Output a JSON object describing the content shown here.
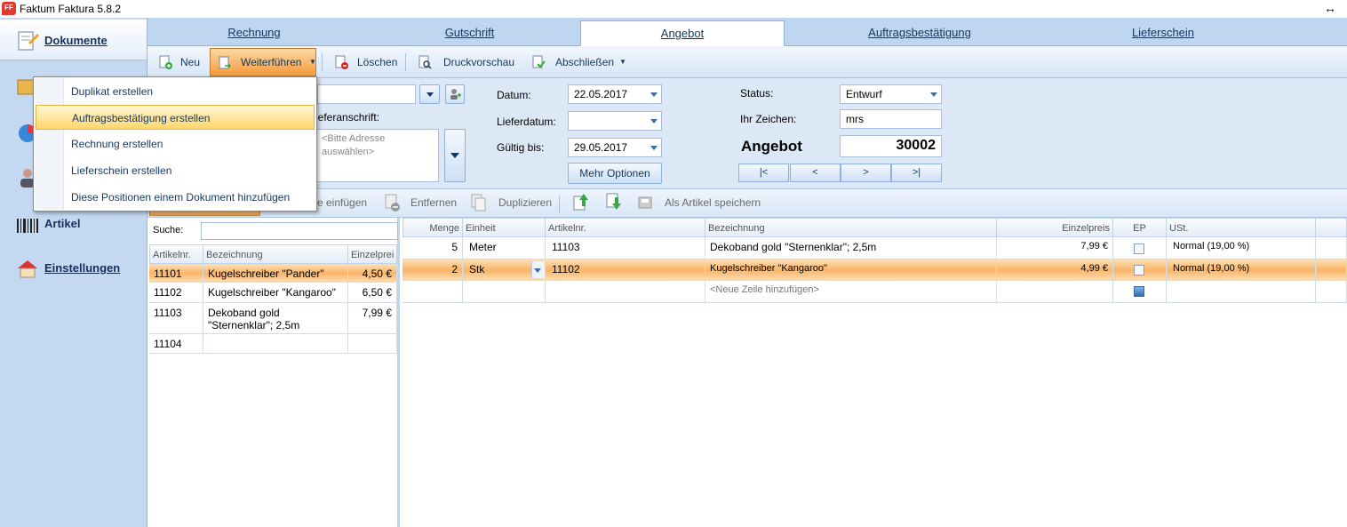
{
  "window": {
    "title": "Faktum Faktura 5.8.2",
    "logo_text": "FF"
  },
  "nav": {
    "items": [
      {
        "label": "Dokumente",
        "icon": "documents-icon"
      },
      {
        "label": "",
        "icon": "folder-icon"
      },
      {
        "label": "",
        "icon": "chart-icon"
      },
      {
        "label": "",
        "icon": "person-icon"
      },
      {
        "label": "Artikel",
        "icon": "barcode-icon"
      },
      {
        "label": "Einstellungen",
        "icon": "house-icon"
      }
    ]
  },
  "tabs": [
    "Rechnung",
    "Gutschrift",
    "Angebot",
    "Auftragsbestätigung",
    "Lieferschein"
  ],
  "active_tab": "Angebot",
  "toolbar": {
    "new": "Neu",
    "continue": "Weiterführen",
    "delete": "Löschen",
    "preview": "Druckvorschau",
    "complete": "Abschließen"
  },
  "menu": {
    "items": [
      "Duplikat erstellen",
      "Auftragsbestätigung erstellen",
      "Rechnung erstellen",
      "Lieferschein erstellen",
      "Diese Positionen einem Dokument hinzufügen"
    ],
    "highlighted": 1
  },
  "form": {
    "delivery_address_label": "ieferanschrift:",
    "address_placeholder_line1": "<Bitte Adresse",
    "address_placeholder_line2": "auswählen>",
    "date_label": "Datum:",
    "date_value": "22.05.2017",
    "delivery_date_label": "Lieferdatum:",
    "delivery_date_value": "",
    "valid_until_label": "Gültig bis:",
    "valid_until_value": "29.05.2017",
    "more_options": "Mehr Optionen",
    "status_label": "Status:",
    "status_value": "Entwurf",
    "your_sign_label": "Ihr Zeichen:",
    "your_sign_value": "mrs",
    "doc_type": "Angebot",
    "doc_number": "30002",
    "nav_first": "|<",
    "nav_prev": "<",
    "nav_next": ">",
    "nav_last": ">|"
  },
  "positions_toolbar": {
    "insert": "e einfügen",
    "remove": "Entfernen",
    "duplicate": "Duplizieren",
    "save_as_article": "Als Artikel speichern"
  },
  "articles": {
    "search_label": "Suche:",
    "headers": [
      "Artikelnr.",
      "Bezeichnung",
      "Einzelprei"
    ],
    "rows": [
      {
        "nr": "11101",
        "name": "Kugelschreiber \"Pander\"",
        "price": "4,50 €"
      },
      {
        "nr": "11102",
        "name": "Kugelschreiber \"Kangaroo\"",
        "price": "6,50 €"
      },
      {
        "nr": "11103",
        "name": "Dekoband gold \"Sternenklar\"; 2,5m",
        "price": "7,99 €"
      },
      {
        "nr": "11104",
        "name": "",
        "price": ""
      }
    ]
  },
  "positions": {
    "headers": [
      "Menge",
      "Einheit",
      "Artikelnr.",
      "Bezeichnung",
      "Einzelpreis",
      "EP",
      "USt."
    ],
    "rows": [
      {
        "qty": "5",
        "unit": "Meter",
        "nr": "11103",
        "name": "Dekoband gold \"Sternenklar\"; 2,5m",
        "price": "7,99 €",
        "vat": "Normal (19,00 %)"
      },
      {
        "qty": "2",
        "unit": "Stk",
        "nr": "11102",
        "name": "Kugelschreiber \"Kangaroo\"",
        "price": "4,99 €",
        "vat": "Normal (19,00 %)"
      }
    ],
    "new_row": "<Neue Zeile hinzufügen>"
  }
}
